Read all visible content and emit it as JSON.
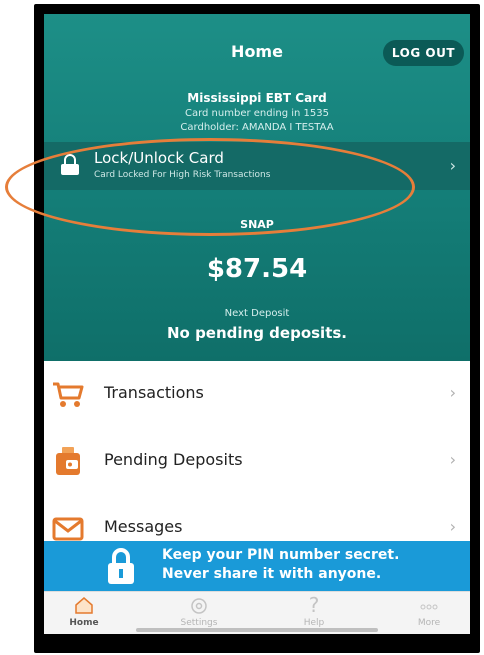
{
  "header": {
    "title": "Home",
    "logout_label": "LOG OUT",
    "card_name": "Mississippi EBT Card",
    "card_number_line": "Card number ending in 1535",
    "cardholder_line": "Cardholder: AMANDA I TESTAA"
  },
  "lock_row": {
    "title": "Lock/Unlock Card",
    "subtitle": "Card Locked For High Risk Transactions",
    "icon": "padlock-icon"
  },
  "balance": {
    "label": "SNAP",
    "amount": "$87.54",
    "next_deposit_label": "Next Deposit",
    "next_deposit_value": "No pending deposits."
  },
  "menu": [
    {
      "label": "Transactions",
      "icon": "shopping-cart-icon"
    },
    {
      "label": "Pending Deposits",
      "icon": "pending-deposit-icon"
    },
    {
      "label": "Messages",
      "icon": "envelope-icon"
    }
  ],
  "banner": {
    "line1": "Keep your PIN number secret.",
    "line2": "Never share it with anyone.",
    "icon": "padlock-icon"
  },
  "tabs": [
    {
      "label": "Home",
      "icon": "home-icon",
      "active": true
    },
    {
      "label": "Settings",
      "icon": "gear-icon",
      "active": false
    },
    {
      "label": "Help",
      "icon": "question-icon",
      "active": false
    },
    {
      "label": "More",
      "icon": "more-dots-icon",
      "active": false
    }
  ],
  "colors": {
    "header_teal": "#15807a",
    "lock_row": "#146a66",
    "accent_orange": "#e67e3a",
    "banner_blue": "#1a9ad8"
  }
}
